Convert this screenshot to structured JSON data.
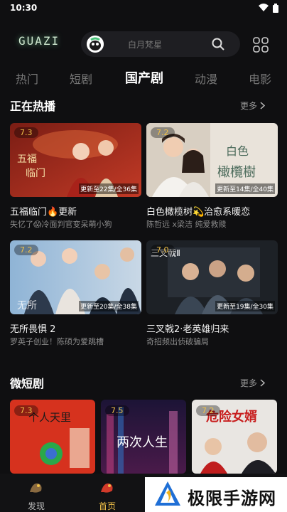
{
  "status": {
    "time": "10:30"
  },
  "header": {
    "logo": "GUAZI",
    "search_placeholder": "白月梵星"
  },
  "tabs": [
    "热门",
    "短剧",
    "国产剧",
    "动漫",
    "电影"
  ],
  "hot": {
    "title": "正在热播",
    "more": "更多",
    "cards": [
      {
        "score": "7.3",
        "episode": "更新至22集/全36集",
        "title": "五福临门🔥更新",
        "subtitle": "失忆了😱冷面判官变呆萌小狗"
      },
      {
        "score": "7.2",
        "episode": "更新至14集/全40集",
        "title": "白色橄榄树💫治愈系暖恋",
        "subtitle": "陈哲远 x梁洁 纯爱救赎"
      },
      {
        "score": "7.2",
        "episode": "更新至20集/全38集",
        "title": "无所畏惧 2",
        "subtitle": "罗英子创业！陈硕为爱跳槽"
      },
      {
        "score": "7.0",
        "episode": "更新至19集/全30集",
        "title": "三叉戟2·老英雄归来",
        "subtitle": "奇招频出侦破骗局"
      }
    ]
  },
  "short": {
    "title": "微短剧",
    "more": "更多",
    "cards": [
      {
        "score": "7.3"
      },
      {
        "score": "7.5"
      },
      {
        "score": "7.2"
      }
    ]
  },
  "nav": {
    "discover": "发现",
    "home": "首页"
  },
  "watermark": {
    "text": "极限手游网"
  },
  "colors": {
    "accent": "#f0c048",
    "background": "#0f0f11"
  }
}
